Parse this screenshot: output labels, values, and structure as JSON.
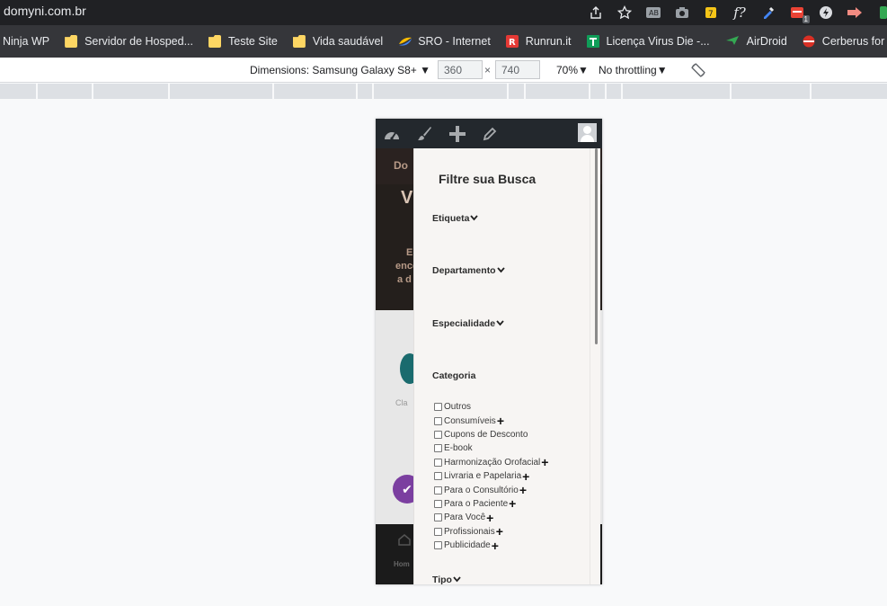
{
  "browser": {
    "url": "domyni.com.br",
    "extension_badge": "1",
    "bookmarks": [
      {
        "label": "Ninja WP",
        "icon": "none"
      },
      {
        "label": "Servidor de Hosped...",
        "icon": "folder-icon"
      },
      {
        "label": "Teste Site",
        "icon": "folder-icon"
      },
      {
        "label": "Vida saudável",
        "icon": "folder-icon"
      },
      {
        "label": "SRO - Internet",
        "icon": "sro-icon"
      },
      {
        "label": "Runrun.it",
        "icon": "runrun-icon"
      },
      {
        "label": "Licença Virus Die -...",
        "icon": "licenca-icon"
      },
      {
        "label": "AirDroid",
        "icon": "airdroid-icon"
      },
      {
        "label": "Cerberus for Andro",
        "icon": "cerberus-icon"
      }
    ]
  },
  "devtools": {
    "dimensions_label": "Dimensions: Samsung Galaxy S8+",
    "width_value": "360",
    "times": "×",
    "height_value": "740",
    "zoom": "70%",
    "throttling": "No throttling"
  },
  "site": {
    "behind_text_1": "Do",
    "behind_text_2": "V",
    "behind_text_3": "E",
    "behind_text_4": "enco",
    "behind_text_5": "a d",
    "behind_text_6": "Cla",
    "behind_text_7": "Hom"
  },
  "filter": {
    "title": "Filtre sua Busca",
    "sections": {
      "etiqueta": "Etiqueta",
      "departamento": "Departamento",
      "especialidade": "Especialidade",
      "categoria": "Categoria",
      "tipo": "Tipo"
    },
    "categories": [
      {
        "label": "Outros",
        "expandable": false
      },
      {
        "label": "Consumíveis",
        "expandable": true
      },
      {
        "label": "Cupons de Desconto",
        "expandable": false
      },
      {
        "label": "E-book",
        "expandable": false
      },
      {
        "label": "Harmonização Orofacial",
        "expandable": true
      },
      {
        "label": "Livraria e Papelaria",
        "expandable": true
      },
      {
        "label": "Para o Consultório",
        "expandable": true
      },
      {
        "label": "Para o Paciente",
        "expandable": true
      },
      {
        "label": "Para Você",
        "expandable": true
      },
      {
        "label": "Profissionais",
        "expandable": true
      },
      {
        "label": "Publicidade",
        "expandable": true
      }
    ]
  },
  "colors": {
    "wp_admin_bar": "#23282d",
    "panel_bg": "#f7f5f3",
    "chat_button": "#7b3fa0"
  }
}
